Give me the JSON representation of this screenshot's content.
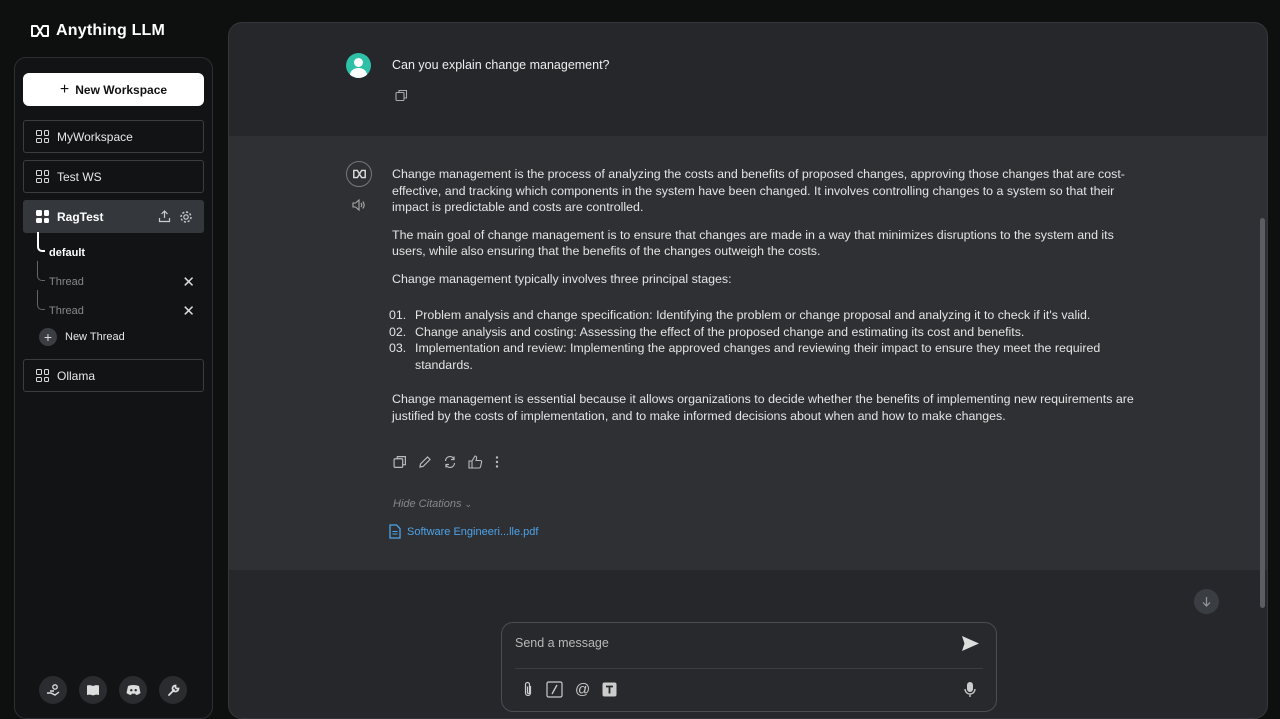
{
  "app": {
    "name": "Anything LLM"
  },
  "sidebar": {
    "new_workspace_label": "New Workspace",
    "workspaces": [
      {
        "label": "MyWorkspace"
      },
      {
        "label": "Test WS"
      },
      {
        "label": "RagTest"
      },
      {
        "label": "Ollama"
      }
    ],
    "threads": [
      {
        "label": "default"
      },
      {
        "label": "Thread"
      },
      {
        "label": "Thread"
      }
    ],
    "new_thread_label": "New Thread"
  },
  "chat": {
    "user_message": "Can you explain change management?",
    "answer": {
      "p1": "Change management is the process of analyzing the costs and benefits of proposed changes, approving those changes that are cost-effective, and tracking which components in the system have been changed. It involves controlling changes to a system so that their impact is predictable and costs are controlled.",
      "p2": "The main goal of change management is to ensure that changes are made in a way that minimizes disruptions to the system and its users, while also ensuring that the benefits of the changes outweigh the costs.",
      "p3": "Change management typically involves three principal stages:",
      "list": [
        {
          "num": "01.",
          "text": "Problem analysis and change specification: Identifying the problem or change proposal and analyzing it to check if it's valid."
        },
        {
          "num": "02.",
          "text": "Change analysis and costing: Assessing the effect of the proposed change and estimating its cost and benefits."
        },
        {
          "num": "03.",
          "text": "Implementation and review: Implementing the approved changes and reviewing their impact to ensure they meet the required standards."
        }
      ],
      "p4": "Change management is essential because it allows organizations to decide whether the benefits of implementing new requirements are justified by the costs of implementation, and to make informed decisions about when and how to make changes."
    },
    "hide_citations_label": "Hide Citations",
    "citation_file": "Software Engineeri...lle.pdf"
  },
  "input": {
    "placeholder": "Send a message"
  },
  "colors": {
    "accent_avatar": "#2fc1a8",
    "citation_link": "#4da3e8",
    "main_bg": "#25272b",
    "assistant_bg": "#2e3034"
  }
}
